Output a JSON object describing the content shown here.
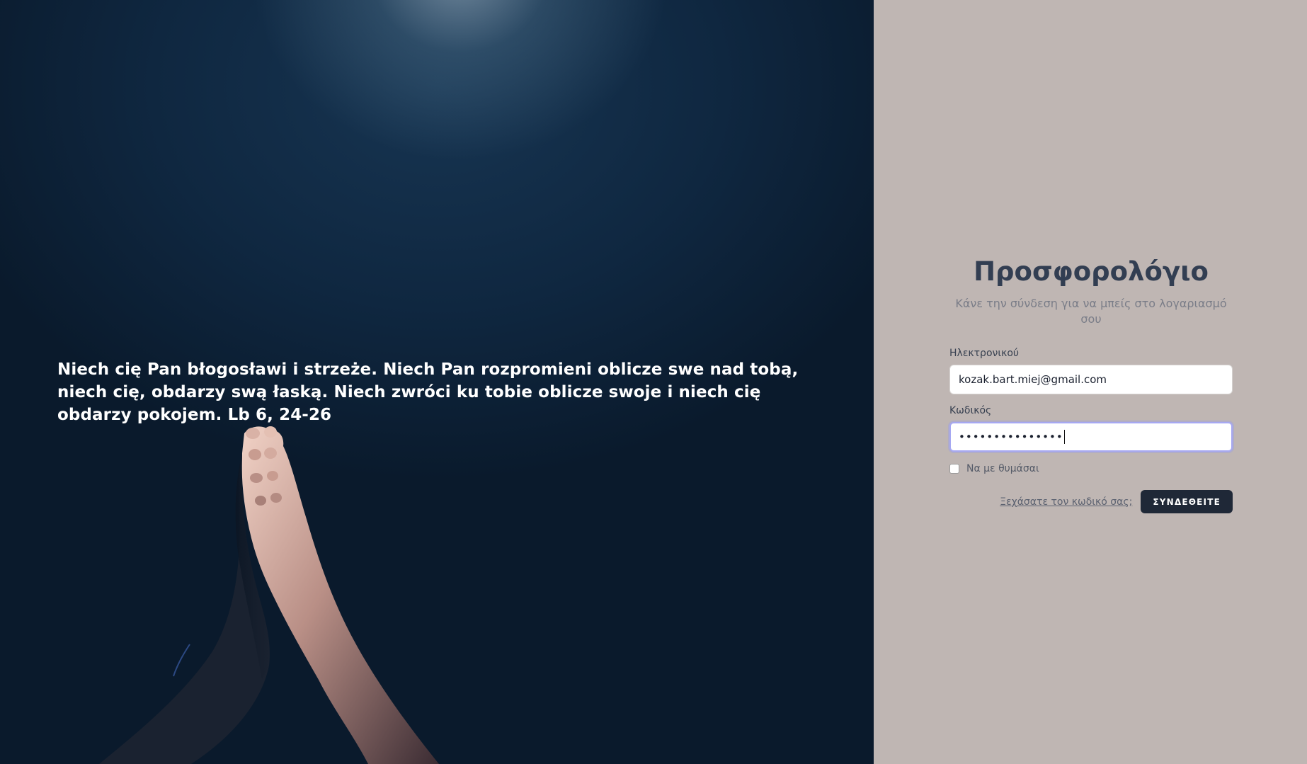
{
  "hero": {
    "quote": "Niech cię Pan błogosławi i strzeże. Niech Pan rozpromieni oblicze swe nad tobą, niech cię, obdarzy swą łaską. Niech zwróci ku tobie oblicze swoje i niech cię obdarzy pokojem. Lb 6, 24-26",
    "image": "praying-hands-photo"
  },
  "login": {
    "title": "Προσφορολόγιο",
    "subtitle": "Κάνε την σύνδεση για να μπείς στο λογαριασμό σου",
    "email_label": "Ηλεκτρονικού",
    "email_value": "kozak.bart.miej@gmail.com",
    "password_label": "Κωδικός",
    "password_masked": "•••••••••••••••",
    "remember_label": "Να με θυμάσαι",
    "remember_checked": false,
    "forgot_link": "Ξεχάσατε τον κωδικό σας;",
    "submit_label": "ΣΥΝΔΕΘΕΙΤΕ"
  },
  "colors": {
    "panel_bg": "#bfb6b3",
    "title": "#323e52",
    "button_bg": "#1f2837",
    "hero_bg": "#0a1a2c"
  }
}
